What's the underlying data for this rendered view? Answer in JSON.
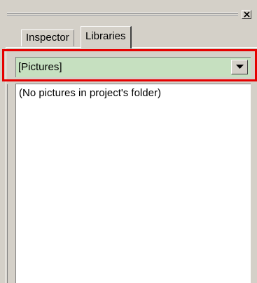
{
  "tabs": [
    {
      "label": "Inspector"
    },
    {
      "label": "Libraries"
    }
  ],
  "library_select": {
    "value": "[Pictures]"
  },
  "list": {
    "empty_message": "(No pictures in project's folder)"
  },
  "colors": {
    "highlight": "#e60000",
    "select_background": "#c6e0c0"
  },
  "icons": {
    "close": "close-icon",
    "dropdown": "dropdown-arrow-icon"
  }
}
